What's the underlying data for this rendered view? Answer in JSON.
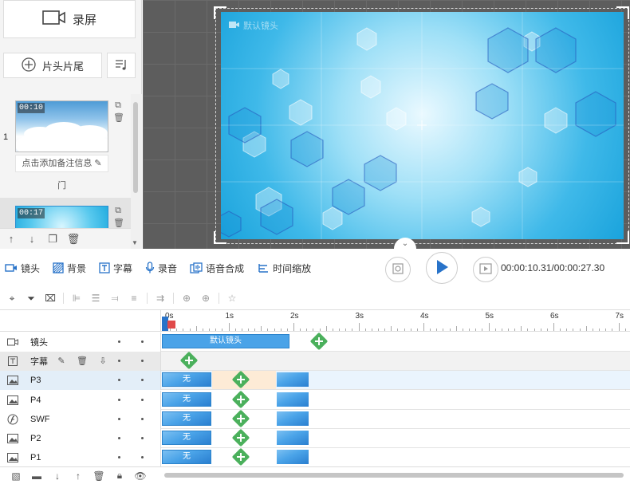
{
  "left_panel": {
    "record_label": "录屏",
    "opening_label": "片头片尾",
    "scenes": [
      {
        "number": "1",
        "duration": "00:10",
        "note": "点击添加备注信息",
        "note_tail": "门"
      },
      {
        "number": "",
        "duration": "00:17",
        "note": "",
        "note_tail": ""
      }
    ]
  },
  "stage": {
    "camera_label": "默认镜头"
  },
  "tools": [
    {
      "label": "镜头",
      "icon": "camera-icon"
    },
    {
      "label": "背景",
      "icon": "background-icon"
    },
    {
      "label": "字幕",
      "icon": "subtitle-icon"
    },
    {
      "label": "录音",
      "icon": "microphone-icon"
    },
    {
      "label": "语音合成",
      "icon": "speech-synthesis-icon"
    },
    {
      "label": "时间缩放",
      "icon": "time-scale-icon"
    }
  ],
  "playback": {
    "timecode": "00:00:10.31/00:00:27.30"
  },
  "ruler": {
    "labels": [
      "0s",
      "1s",
      "2s",
      "3s",
      "4s",
      "5s",
      "6s",
      "7s"
    ]
  },
  "tracks": [
    {
      "name": "镜头",
      "icon": "camera-icon",
      "clip_label": "默认镜头"
    },
    {
      "name": "字幕",
      "icon": "subtitle-icon"
    },
    {
      "name": "P3",
      "icon": "image-icon",
      "clip_label": "无"
    },
    {
      "name": "P4",
      "icon": "image-icon",
      "clip_label": "无"
    },
    {
      "name": "SWF",
      "icon": "flash-icon",
      "clip_label": "无"
    },
    {
      "name": "P2",
      "icon": "image-icon",
      "clip_label": "无"
    },
    {
      "name": "P1",
      "icon": "image-icon",
      "clip_label": "无"
    }
  ],
  "colors": {
    "accent": "#2873c9",
    "clip": "#4aa3e8",
    "keyframe": "#4bb05c",
    "selected_row": "#eaf4fd"
  }
}
